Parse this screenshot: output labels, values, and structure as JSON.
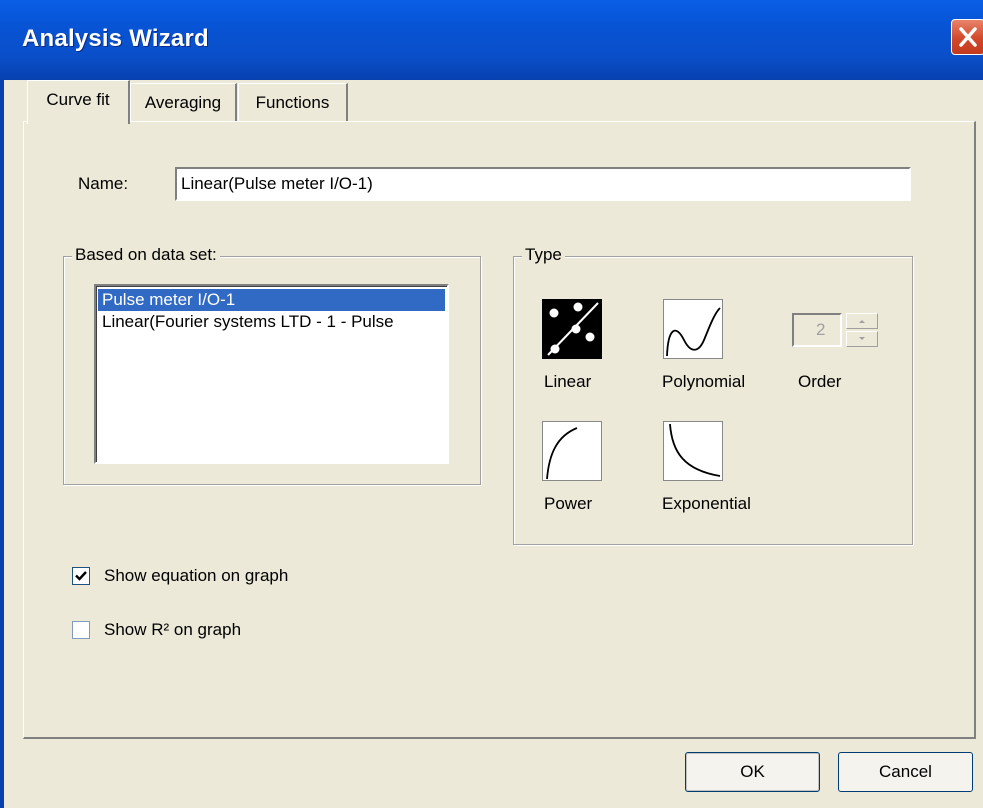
{
  "window": {
    "title": "Analysis Wizard"
  },
  "tabs": [
    {
      "label": "Curve fit",
      "active": true
    },
    {
      "label": "Averaging",
      "active": false
    },
    {
      "label": "Functions",
      "active": false
    }
  ],
  "curve_fit": {
    "name_label": "Name:",
    "name_value": "Linear(Pulse meter I/O-1)",
    "dataset_group_label": "Based on data set:",
    "datasets": [
      {
        "label": "Pulse meter I/O-1",
        "selected": true
      },
      {
        "label": "Linear(Fourier systems LTD - 1 - Pulse",
        "selected": false
      }
    ],
    "type_group_label": "Type",
    "types": {
      "linear": "Linear",
      "polynomial": "Polynomial",
      "power": "Power",
      "exponential": "Exponential"
    },
    "selected_type": "linear",
    "order_label": "Order",
    "order_value": "2",
    "order_enabled": false,
    "show_equation_label": "Show equation on graph",
    "show_equation_checked": true,
    "show_r2_label": "Show R² on graph",
    "show_r2_checked": false
  },
  "buttons": {
    "ok": "OK",
    "cancel": "Cancel"
  },
  "colors": {
    "titlebar": "#0a4fc9",
    "selection": "#316ac5",
    "dialog_bg": "#ece9d8",
    "close_button": "#d2482a"
  }
}
